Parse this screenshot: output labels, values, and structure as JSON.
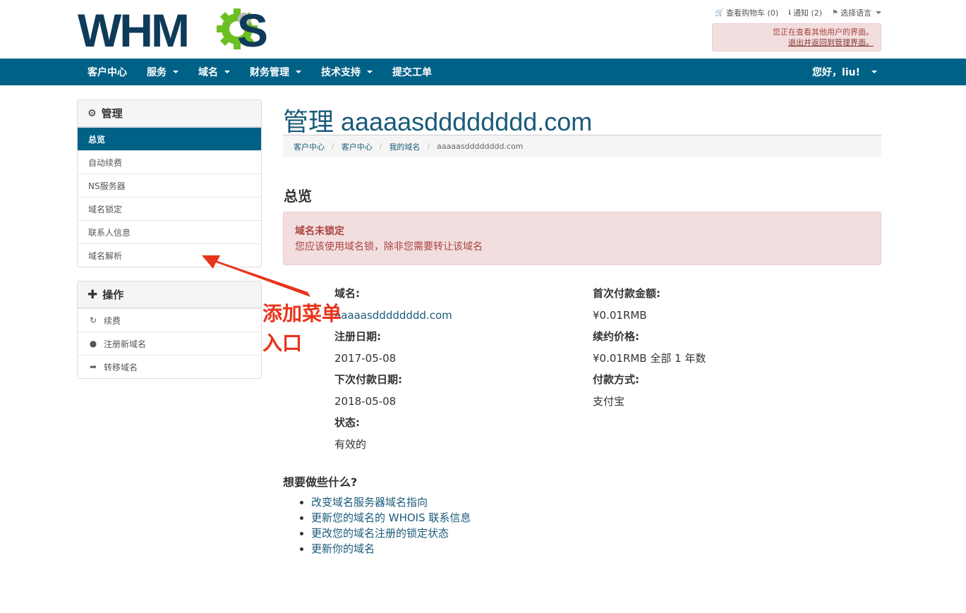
{
  "brand": {
    "logo_text": "WHMCS",
    "navy": "#0f3b5a",
    "green": "#6bbf22",
    "nav_bg": "#006187"
  },
  "topbar": {
    "cart_icon": "cart-icon",
    "cart": "查看购物车 (0)",
    "notify_icon": "info-icon",
    "notify": "通知 (2)",
    "lang_icon": "language-icon",
    "lang": "选择语言"
  },
  "impersonate": {
    "line1": "您正在查看其他用户的界面。",
    "line2": "退出并返回到管理界面。"
  },
  "nav": {
    "items": [
      {
        "label": "客户中心"
      },
      {
        "label": "服务"
      },
      {
        "label": "域名"
      },
      {
        "label": "财务管理"
      },
      {
        "label": "技术支持"
      },
      {
        "label": "提交工单"
      }
    ],
    "greeting": "您好，liu!"
  },
  "sidebar": {
    "manage": {
      "title": "管理",
      "icon": "gear-icon",
      "items": [
        {
          "label": "总览",
          "active": true
        },
        {
          "label": "自动续费"
        },
        {
          "label": "NS服务器"
        },
        {
          "label": "域名锁定"
        },
        {
          "label": "联系人信息"
        },
        {
          "label": "域名解析"
        }
      ]
    },
    "actions": {
      "title": "操作",
      "icon": "plus-icon",
      "items": [
        {
          "label": "续费",
          "icon": "refresh-icon"
        },
        {
          "label": "注册新域名",
          "icon": "globe-icon"
        },
        {
          "label": "转移域名",
          "icon": "share-icon"
        }
      ]
    }
  },
  "page": {
    "title": "管理 aaaaasdddddddd.com",
    "breadcrumb": [
      "客户中心",
      "客户中心",
      "我的域名",
      "aaaaasdddddddd.com"
    ],
    "section": "总览"
  },
  "alert": {
    "title": "域名未锁定",
    "text": "您应该使用域名锁，除非您需要转让该域名"
  },
  "details": {
    "left": [
      {
        "label": "域名:",
        "value": "aaaaasdddddddd.com"
      },
      {
        "label": "注册日期:",
        "value": "2017-05-08"
      },
      {
        "label": "下次付款日期:",
        "value": "2018-05-08"
      },
      {
        "label": "状态:",
        "value": "有效的"
      }
    ],
    "right": [
      {
        "label": "首次付款金额:",
        "value": "¥0.01RMB"
      },
      {
        "label": "续约价格:",
        "value": "¥0.01RMB 全部 1 年数"
      },
      {
        "label": "付款方式:",
        "value": "支付宝"
      }
    ]
  },
  "todo": {
    "title": "想要做些什么?",
    "links": [
      "改变域名服务器域名指向",
      "更新您的域名的 WHOIS 联系信息",
      "更改您的域名注册的锁定状态",
      "更新你的域名"
    ]
  },
  "annotation": {
    "line1": "添加菜单",
    "line2": "入口",
    "color": "#e8341c"
  }
}
